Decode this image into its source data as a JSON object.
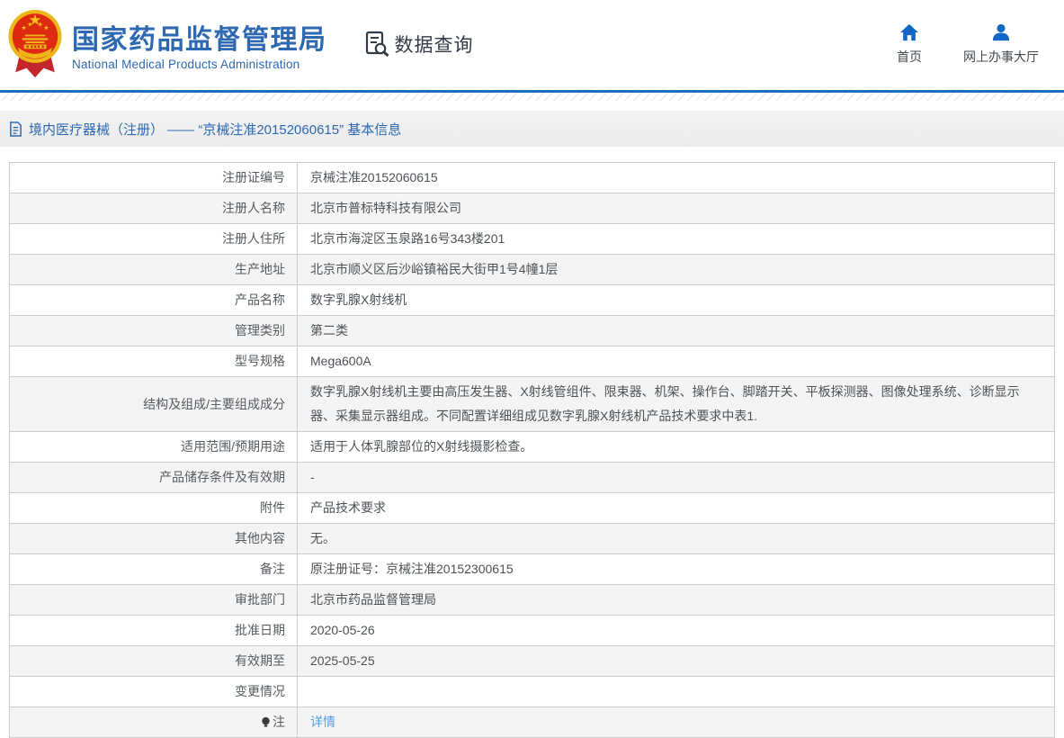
{
  "header": {
    "site_title": "国家药品监督管理局",
    "site_subtitle": "National Medical Products Administration",
    "section_title": "数据查询",
    "nav": [
      {
        "label": "首页",
        "icon": "home-icon"
      },
      {
        "label": "网上办事大厅",
        "icon": "user-icon"
      }
    ]
  },
  "breadcrumb": {
    "icon": "document-icon",
    "text": "境内医疗器械（注册） —— “京械注准20152060615” 基本信息"
  },
  "table": {
    "rows": [
      {
        "label": "注册证编号",
        "value": "京械注准20152060615"
      },
      {
        "label": "注册人名称",
        "value": "北京市普标特科技有限公司"
      },
      {
        "label": "注册人住所",
        "value": "北京市海淀区玉泉路16号343楼201"
      },
      {
        "label": "生产地址",
        "value": "北京市顺义区后沙峪镇裕民大街甲1号4幢1层"
      },
      {
        "label": "产品名称",
        "value": "数字乳腺X射线机"
      },
      {
        "label": "管理类别",
        "value": "第二类"
      },
      {
        "label": "型号规格",
        "value": "Mega600A"
      },
      {
        "label": "结构及组成/主要组成成分",
        "value": "数字乳腺X射线机主要由高压发生器、X射线管组件、限束器、机架、操作台、脚踏开关、平板探测器、图像处理系统、诊断显示器、采集显示器组成。不同配置详细组成见数字乳腺X射线机产品技术要求中表1."
      },
      {
        "label": "适用范围/预期用途",
        "value": "适用于人体乳腺部位的X射线摄影检查。"
      },
      {
        "label": "产品储存条件及有效期",
        "value": "-"
      },
      {
        "label": "附件",
        "value": "产品技术要求"
      },
      {
        "label": "其他内容",
        "value": "无。"
      },
      {
        "label": "备注",
        "value": "原注册证号：京械注准20152300615"
      },
      {
        "label": "审批部门",
        "value": "北京市药品监督管理局"
      },
      {
        "label": "批准日期",
        "value": "2020-05-26"
      },
      {
        "label": "有效期至",
        "value": "2025-05-25"
      },
      {
        "label": "变更情况",
        "value": ""
      },
      {
        "label": "注",
        "label_icon": "bulb-icon",
        "value": "详情",
        "value_type": "link"
      }
    ]
  },
  "colors": {
    "brand_blue": "#2d68b1",
    "icon_blue": "#1266c5",
    "divider_blue": "#1c6fc0",
    "link_blue": "#4f9fe8",
    "bar_gray": "#ebebeb",
    "border_gray": "#cccccc",
    "row_alt_bg": "#f4f4f4",
    "dark_icon": "#333b46"
  }
}
